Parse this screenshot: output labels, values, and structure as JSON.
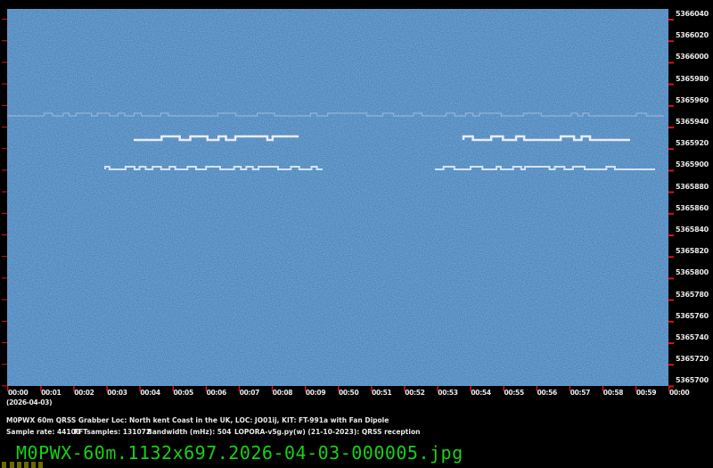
{
  "y_axis": {
    "unit": "Hz",
    "labels": [
      "5366040",
      "5366020",
      "5366000",
      "5365980",
      "5365960",
      "5365940",
      "5365920",
      "5365900",
      "5365880",
      "5365860",
      "5365840",
      "5365820",
      "5365800",
      "5365780",
      "5365760",
      "5365740",
      "5365720",
      "5365700"
    ]
  },
  "x_axis": {
    "date": "(2026-04-03)",
    "labels": [
      "00:00",
      "00:01",
      "00:02",
      "00:03",
      "00:04",
      "00:05",
      "00:06",
      "00:07",
      "00:08",
      "00:09",
      "00:50",
      "00:51",
      "00:52",
      "00:53",
      "00:54",
      "00:55",
      "00:56",
      "00:57",
      "00:58",
      "00:59",
      "00:00"
    ]
  },
  "info": {
    "line1": "M0PWX 60m QRSS Grabber Loc: North kent Coast in the UK, LOC: JO01ij, KIT: FT-991a with Fan Dipole",
    "sample_rate": "Sample rate: 44100",
    "fft": "FFTsamples: 131072",
    "bandwidth": "Bandwidth (mHz): 504",
    "software": "LOPORA-v5g.py(w) (21-10-2023): QRSS reception"
  },
  "filename": "M0PWX-60m.1132x697.2026-04-03-000005.jpg",
  "colors": {
    "background": "#1e4a8c",
    "tick": "#e01010",
    "filename": "#18d018"
  }
}
